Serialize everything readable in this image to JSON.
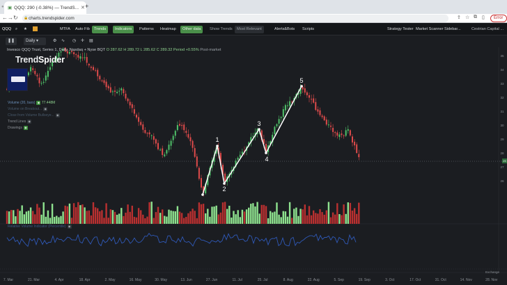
{
  "browser": {
    "tab_title": "QQQ: 290 (-0.38%) — TrendS...",
    "url": "charts.trendspider.com",
    "error_button": "Error",
    "new_tab": "+"
  },
  "toolbar": {
    "symbol": "QQQ",
    "items": [
      "MTFA",
      "Auto Fib",
      "Trends",
      "Indicators",
      "Patterns",
      "Heatmap",
      "Other data",
      "Show Trends",
      "Most Relevant",
      "Alerts&Bots",
      "Scripts",
      "Strategy Tester",
      "Market Scanner",
      "Sidebar...",
      "Cestrian Capital ..."
    ],
    "active": [
      "Trends",
      "Indicators",
      "Other data"
    ]
  },
  "subbar": {
    "timeframe": "Daily"
  },
  "legend": {
    "title": "Invesco QQQ Trust, Series 1, Daily, Nasdaq + Nyse BQT",
    "open": "O 287.62",
    "high": "H 289.72",
    "low": "L 285.62",
    "close": "C 289.32",
    "period": "Period +0.55%",
    "post": "Post-market"
  },
  "logo": {
    "trend": "Trend",
    "spider": "Spider"
  },
  "indicators": [
    {
      "label": "Volume (20, bars)",
      "value": "77.448M"
    },
    {
      "label": "Volume on Breakout..."
    },
    {
      "label": "Close from Volume Bullseye..."
    },
    {
      "label": "Trend Lines"
    },
    {
      "label": "Drawings"
    }
  ],
  "lower_panel": {
    "label": "Relative Volume Indicator (Percentile)"
  },
  "price_tag": "29",
  "time_axis": [
    "7. Mar",
    "21. Mar",
    "4. Apr",
    "18. Apr",
    "2. May",
    "16. May",
    "30. May",
    "13. Jun",
    "27. Jun",
    "11. Jul",
    "25. Jul",
    "8. Aug",
    "22. Aug",
    "5. Sep",
    "19. Sep",
    "3. Oct",
    "17. Oct",
    "31. Oct",
    "14. Nov",
    "28. Nov"
  ],
  "price_axis": [
    "35",
    "34",
    "33",
    "32",
    "31",
    "30",
    "29",
    "28",
    "27",
    "26"
  ],
  "exchange_label": "Exchange",
  "wave_labels": [
    "1",
    "2",
    "3",
    "4",
    "5"
  ],
  "colors": {
    "up": "#4fc269",
    "down": "#e04b4b",
    "vol_up": "#8fe38f",
    "vol_down": "#b93030",
    "line": "#2f59b8"
  }
}
